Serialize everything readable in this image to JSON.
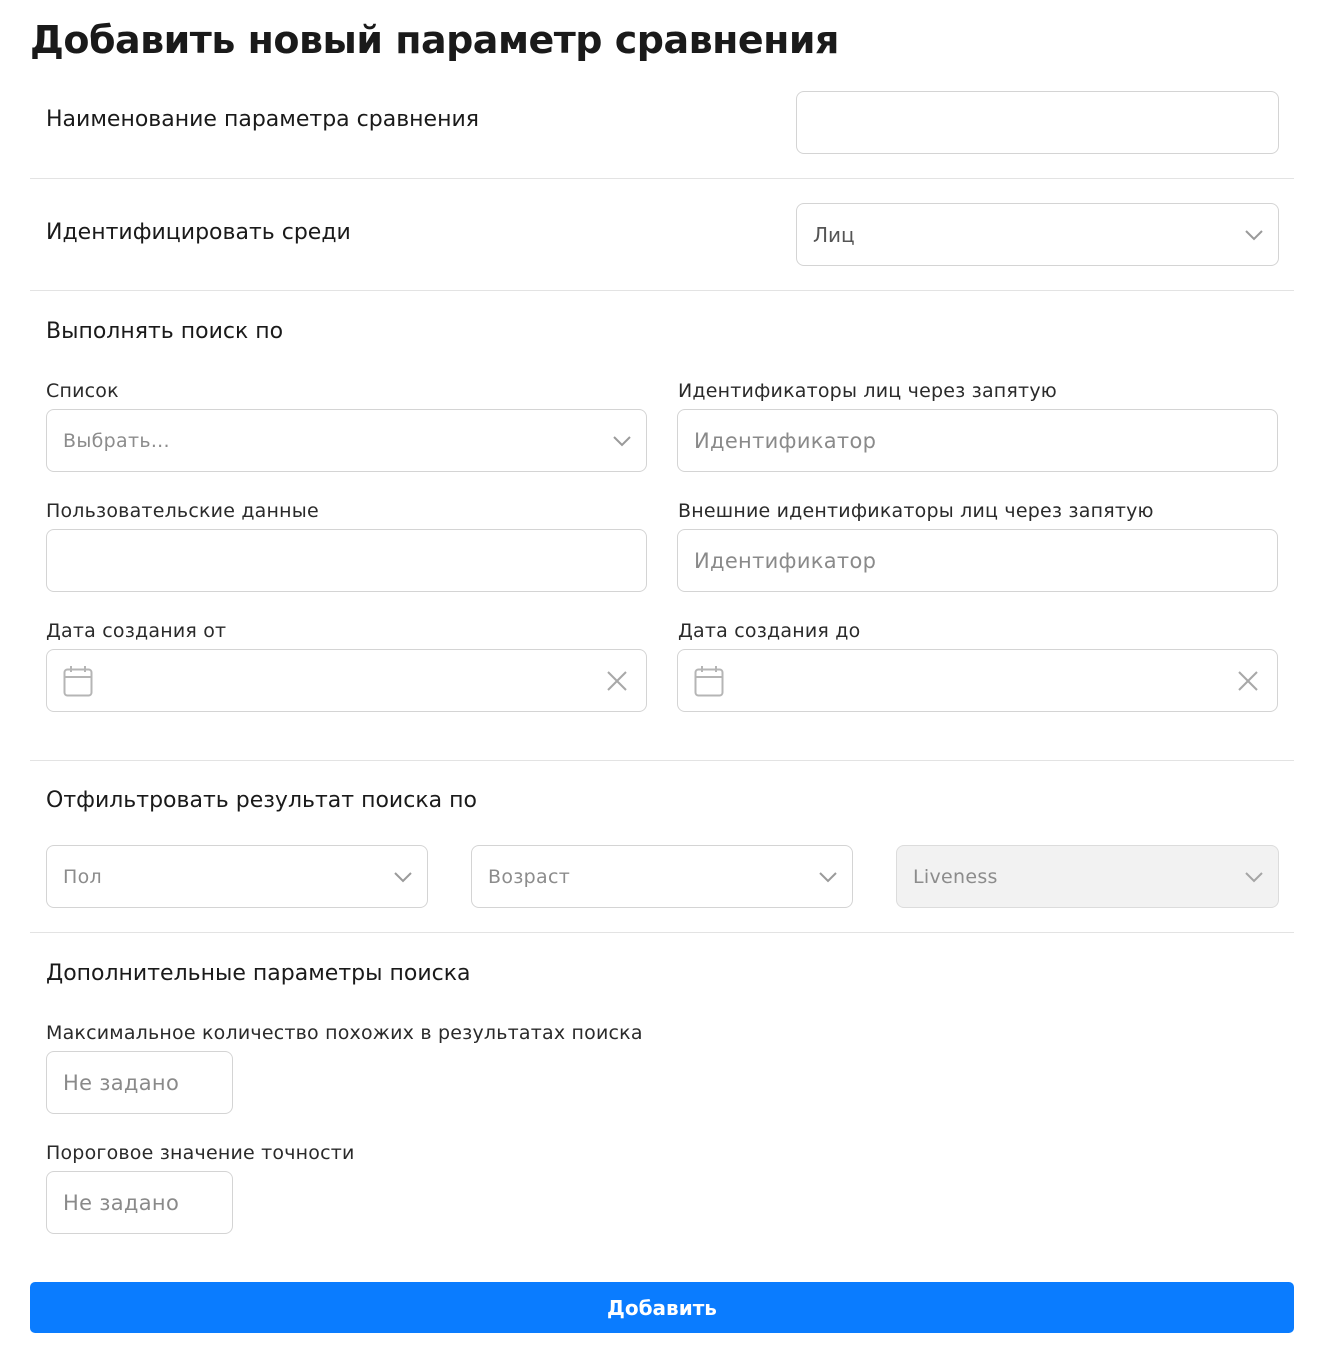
{
  "page": {
    "title": "Добавить новый параметр сравнения"
  },
  "name_row": {
    "label": "Наименование параметра сравнения",
    "value": ""
  },
  "identify_row": {
    "label": "Идентифицировать среди",
    "value": "Лиц"
  },
  "search_section": {
    "title": "Выполнять поиск по",
    "list": {
      "label": "Список",
      "placeholder": "Выбрать..."
    },
    "face_ids": {
      "label": "Идентификаторы лиц через запятую",
      "placeholder": "Идентификатор"
    },
    "user_data": {
      "label": "Пользовательские данные",
      "value": ""
    },
    "external_ids": {
      "label": "Внешние идентификаторы лиц через запятую",
      "placeholder": "Идентификатор"
    },
    "date_from": {
      "label": "Дата создания от"
    },
    "date_to": {
      "label": "Дата создания до"
    }
  },
  "filter_section": {
    "title": "Отфильтровать результат поиска по",
    "gender": {
      "placeholder": "Пол"
    },
    "age": {
      "placeholder": "Возраст"
    },
    "liveness": {
      "placeholder": "Liveness",
      "disabled": true
    }
  },
  "extra_section": {
    "title": "Дополнительные параметры поиска",
    "max_similar": {
      "label": "Максимальное количество похожих в результатах поиска",
      "placeholder": "Не задано"
    },
    "threshold": {
      "label": "Пороговое значение точности",
      "placeholder": "Не задано"
    }
  },
  "submit": {
    "label": "Добавить"
  },
  "colors": {
    "accent": "#0a7cff",
    "border": "#d4d4d4",
    "disabled_bg": "#f2f2f2"
  },
  "icons": {
    "select": "chevron-down-icon",
    "date": "calendar-icon",
    "clear": "close-icon"
  }
}
